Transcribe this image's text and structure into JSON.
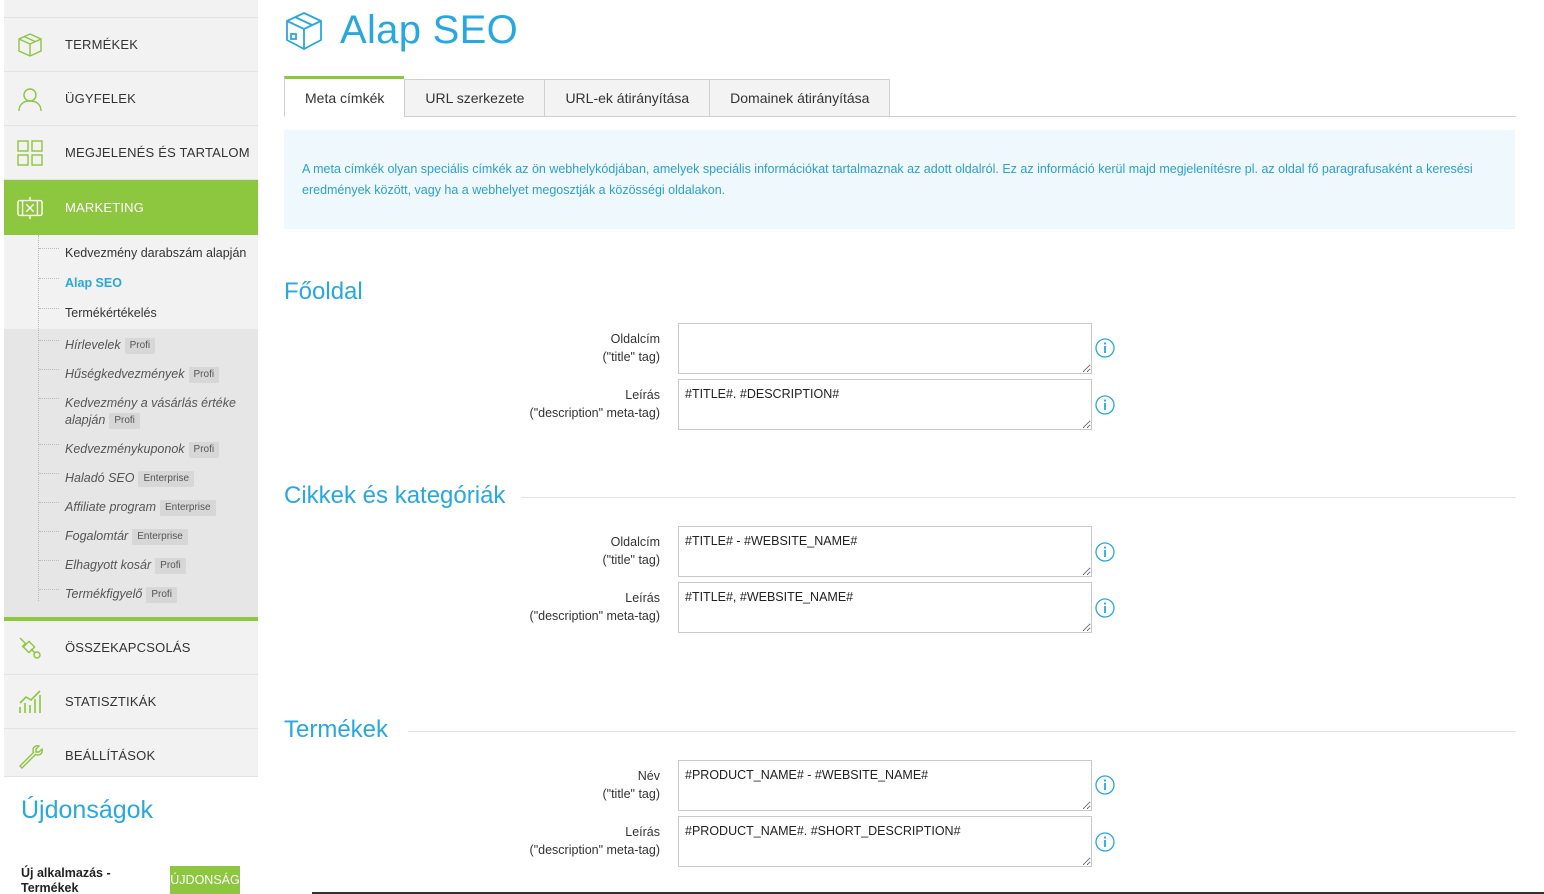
{
  "sidebar": {
    "nav_top": [
      {
        "label": "TERMÉKEK",
        "icon": "box-icon"
      },
      {
        "label": "ÜGYFELEK",
        "icon": "user-icon"
      },
      {
        "label": "MEGJELENÉS ÉS TARTALOM",
        "icon": "layout-grid-icon"
      }
    ],
    "active": {
      "label": "MARKETING",
      "icon": "megaphone-icon"
    },
    "submenu_free": [
      "Kedvezmény darabszám alapján",
      "Alap SEO",
      "Termékértékelés"
    ],
    "submenu_locked": [
      {
        "label": "Hírlevelek",
        "badge": "Profi"
      },
      {
        "label": "Hűségkedvezmények",
        "badge": "Profi"
      },
      {
        "label": "Kedvezmény a vásárlás értéke alapján",
        "badge": "Profi"
      },
      {
        "label": "Kedvezménykuponok",
        "badge": "Profi"
      },
      {
        "label": "Haladó SEO",
        "badge": "Enterprise"
      },
      {
        "label": "Affiliate program",
        "badge": "Enterprise"
      },
      {
        "label": "Fogalomtár",
        "badge": "Enterprise"
      },
      {
        "label": "Elhagyott kosár",
        "badge": "Profi"
      },
      {
        "label": "Termékfigyelő",
        "badge": "Profi"
      }
    ],
    "nav_bottom": [
      {
        "label": "ÖSSZEKAPCSOLÁS",
        "icon": "plug-icon"
      },
      {
        "label": "STATISZTIKÁK",
        "icon": "bar-chart-icon"
      },
      {
        "label": "BEÁLLÍTÁSOK",
        "icon": "wrench-icon"
      }
    ],
    "news": {
      "title": "Újdonságok",
      "item": "Új alkalmazás - Termékek",
      "badge": "ÚJDONSÁG"
    }
  },
  "page": {
    "title": "Alap SEO",
    "tabs": [
      "Meta címkék",
      "URL szerkezete",
      "URL-ek átirányítása",
      "Domainek átirányítása"
    ],
    "info": "A meta címkék olyan speciális címkék az ön webhelykódjában, amelyek speciális információkat tartalmaznak az adott oldalról. Ez az információ kerül majd megjelenítésre pl. az oldal fő paragrafusaként a keresési eredmények között, vagy ha a webhelyet megosztják a közösségi oldalakon."
  },
  "sections": {
    "home": {
      "title": "Főoldal",
      "title_label": "Oldalcím",
      "title_sub": "(\"title\" tag)",
      "title_value": "",
      "desc_label": "Leírás",
      "desc_sub": "(\"description\" meta-tag)",
      "desc_value": "#TITLE#. #DESCRIPTION#"
    },
    "articles": {
      "title": "Cikkek és kategóriák",
      "title_label": "Oldalcím",
      "title_sub": "(\"title\" tag)",
      "title_value": "#TITLE# - #WEBSITE_NAME#",
      "desc_label": "Leírás",
      "desc_sub": "(\"description\" meta-tag)",
      "desc_value": "#TITLE#, #WEBSITE_NAME#"
    },
    "products": {
      "title": "Termékek",
      "title_label": "Név",
      "title_sub": "(\"title\" tag)",
      "title_value": "#PRODUCT_NAME# - #WEBSITE_NAME#",
      "desc_label": "Leírás",
      "desc_sub": "(\"description\" meta-tag)",
      "desc_value": "#PRODUCT_NAME#. #SHORT_DESCRIPTION#"
    }
  },
  "colors": {
    "accent_green": "#8dc63f",
    "accent_blue": "#29a8e0",
    "icon_stroke": "#8dc63f"
  }
}
